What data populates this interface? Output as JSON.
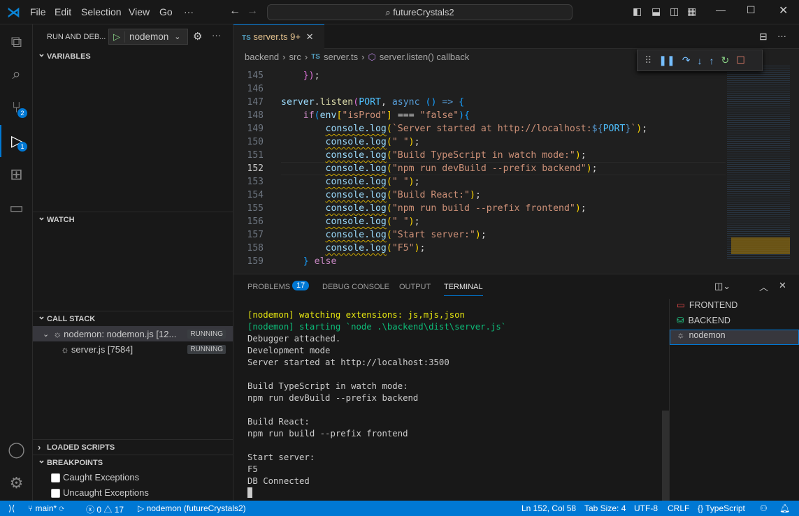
{
  "titlebar": {
    "menus": [
      "File",
      "Edit",
      "Selection",
      "View",
      "Go",
      "···"
    ],
    "search": "futureCrystals2"
  },
  "activity": {
    "scm_badge": "2",
    "debug_badge": "1"
  },
  "sidebar": {
    "title": "RUN AND DEB...",
    "config": "nodemon",
    "variables": "VARIABLES",
    "watch": "WATCH",
    "call_stack": "CALL STACK",
    "stack": [
      {
        "label": "nodemon: nodemon.js [12...",
        "status": "RUNNING"
      },
      {
        "label": "server.js [7584]",
        "status": "RUNNING"
      }
    ],
    "loaded_scripts": "LOADED SCRIPTS",
    "breakpoints": "BREAKPOINTS",
    "bp_items": [
      "Caught Exceptions",
      "Uncaught Exceptions"
    ]
  },
  "editor": {
    "tab": {
      "icon": "TS",
      "name": "server.ts",
      "badge": "9+"
    },
    "breadcrumb": [
      "backend",
      "src",
      "server.ts",
      "server.listen() callback"
    ],
    "line_numbers": [
      "145",
      "146",
      "147",
      "148",
      "149",
      "150",
      "151",
      "152",
      "153",
      "154",
      "155",
      "156",
      "157",
      "158",
      "159"
    ],
    "current_line": "152",
    "lines": [
      [
        {
          "t": "    "
        },
        {
          "t": "})",
          "c": "p2"
        },
        {
          "t": ";",
          "c": "op"
        }
      ],
      [],
      [
        {
          "t": "server",
          "c": "id"
        },
        {
          "t": ".",
          "c": "op"
        },
        {
          "t": "listen",
          "c": "fn"
        },
        {
          "t": "(",
          "c": "p2"
        },
        {
          "t": "PORT",
          "c": "var"
        },
        {
          "t": ", ",
          "c": "op"
        },
        {
          "t": "async",
          "c": "kb"
        },
        {
          "t": " ",
          "c": "op"
        },
        {
          "t": "()",
          "c": "p3"
        },
        {
          "t": " => ",
          "c": "kb"
        },
        {
          "t": "{",
          "c": "p3"
        }
      ],
      [
        {
          "t": "    "
        },
        {
          "t": "if",
          "c": "kw"
        },
        {
          "t": "(",
          "c": "p3"
        },
        {
          "t": "env",
          "c": "id"
        },
        {
          "t": "[",
          "c": "p1"
        },
        {
          "t": "\"isProd\"",
          "c": "str"
        },
        {
          "t": "]",
          "c": "p1"
        },
        {
          "t": " === ",
          "c": "op"
        },
        {
          "t": "\"false\"",
          "c": "str"
        },
        {
          "t": "){",
          "c": "p3"
        }
      ],
      [
        {
          "t": "        "
        },
        {
          "t": "console.log",
          "c": "id",
          "s": 1
        },
        {
          "t": "(",
          "c": "p1"
        },
        {
          "t": "`Server started at ",
          "c": "str"
        },
        {
          "t": "http://localhost:",
          "c": "str"
        },
        {
          "t": "${",
          "c": "kb"
        },
        {
          "t": "PORT",
          "c": "var"
        },
        {
          "t": "}",
          "c": "kb"
        },
        {
          "t": "`",
          "c": "str"
        },
        {
          "t": ")",
          "c": "p1"
        },
        {
          "t": ";",
          "c": "op"
        }
      ],
      [
        {
          "t": "        "
        },
        {
          "t": "console.log",
          "c": "id",
          "s": 1
        },
        {
          "t": "(",
          "c": "p1"
        },
        {
          "t": "\" \"",
          "c": "str"
        },
        {
          "t": ")",
          "c": "p1"
        },
        {
          "t": ";",
          "c": "op"
        }
      ],
      [
        {
          "t": "        "
        },
        {
          "t": "console.log",
          "c": "id",
          "s": 1
        },
        {
          "t": "(",
          "c": "p1"
        },
        {
          "t": "\"Build TypeScript in watch mode:\"",
          "c": "str"
        },
        {
          "t": ")",
          "c": "p1"
        },
        {
          "t": ";",
          "c": "op"
        }
      ],
      [
        {
          "t": "        "
        },
        {
          "t": "console.log",
          "c": "id",
          "s": 1
        },
        {
          "t": "(",
          "c": "p1"
        },
        {
          "t": "\"npm run devBuild --prefix backend\"",
          "c": "str"
        },
        {
          "t": ")",
          "c": "p1"
        },
        {
          "t": ";",
          "c": "op"
        }
      ],
      [
        {
          "t": "        "
        },
        {
          "t": "console.log",
          "c": "id",
          "s": 1
        },
        {
          "t": "(",
          "c": "p1"
        },
        {
          "t": "\" \"",
          "c": "str"
        },
        {
          "t": ")",
          "c": "p1"
        },
        {
          "t": ";",
          "c": "op"
        }
      ],
      [
        {
          "t": "        "
        },
        {
          "t": "console.log",
          "c": "id",
          "s": 1
        },
        {
          "t": "(",
          "c": "p1"
        },
        {
          "t": "\"Build React:\"",
          "c": "str"
        },
        {
          "t": ")",
          "c": "p1"
        },
        {
          "t": ";",
          "c": "op"
        }
      ],
      [
        {
          "t": "        "
        },
        {
          "t": "console.log",
          "c": "id",
          "s": 1
        },
        {
          "t": "(",
          "c": "p1"
        },
        {
          "t": "\"npm run build --prefix frontend\"",
          "c": "str"
        },
        {
          "t": ")",
          "c": "p1"
        },
        {
          "t": ";",
          "c": "op"
        }
      ],
      [
        {
          "t": "        "
        },
        {
          "t": "console.log",
          "c": "id",
          "s": 1
        },
        {
          "t": "(",
          "c": "p1"
        },
        {
          "t": "\" \"",
          "c": "str"
        },
        {
          "t": ")",
          "c": "p1"
        },
        {
          "t": ";",
          "c": "op"
        }
      ],
      [
        {
          "t": "        "
        },
        {
          "t": "console.log",
          "c": "id",
          "s": 1
        },
        {
          "t": "(",
          "c": "p1"
        },
        {
          "t": "\"Start server:\"",
          "c": "str"
        },
        {
          "t": ")",
          "c": "p1"
        },
        {
          "t": ";",
          "c": "op"
        }
      ],
      [
        {
          "t": "        "
        },
        {
          "t": "console.log",
          "c": "id",
          "s": 1
        },
        {
          "t": "(",
          "c": "p1"
        },
        {
          "t": "\"F5\"",
          "c": "str"
        },
        {
          "t": ")",
          "c": "p1"
        },
        {
          "t": ";",
          "c": "op"
        }
      ],
      [
        {
          "t": "    "
        },
        {
          "t": "}",
          "c": "p3"
        },
        {
          "t": " else",
          "c": "kw"
        }
      ]
    ]
  },
  "panel": {
    "tabs": [
      "PROBLEMS",
      "DEBUG CONSOLE",
      "OUTPUT",
      "TERMINAL"
    ],
    "problems_count": "17",
    "active_tab": "TERMINAL",
    "terminal_lines": [
      {
        "text": "[nodemon] watching extensions: js,mjs,json",
        "color": "#e5e510"
      },
      {
        "text": "[nodemon] starting `node .\\backend\\dist\\server.js`",
        "color": "#0dbc79"
      },
      {
        "text": "Debugger attached."
      },
      {
        "text": "Development mode"
      },
      {
        "text": "Server started at http://localhost:3500"
      },
      {
        "text": ""
      },
      {
        "text": "Build TypeScript in watch mode:"
      },
      {
        "text": "npm run devBuild --prefix backend"
      },
      {
        "text": ""
      },
      {
        "text": "Build React:"
      },
      {
        "text": "npm run build --prefix frontend"
      },
      {
        "text": ""
      },
      {
        "text": "Start server:"
      },
      {
        "text": "F5"
      },
      {
        "text": "DB Connected"
      }
    ],
    "terminals": [
      {
        "name": "FRONTEND",
        "icon": "terminal-icon",
        "color": "#f14c4c"
      },
      {
        "name": "BACKEND",
        "icon": "database-icon",
        "color": "#23d18b"
      },
      {
        "name": "nodemon",
        "icon": "bug-icon",
        "color": "#ccc"
      }
    ]
  },
  "statusbar": {
    "branch": "main*",
    "errors": "0",
    "warnings": "17",
    "debug": "nodemon (futureCrystals2)",
    "position": "Ln 152, Col 58",
    "tab_size": "Tab Size: 4",
    "encoding": "UTF-8",
    "eol": "CRLF",
    "language": "TypeScript"
  }
}
